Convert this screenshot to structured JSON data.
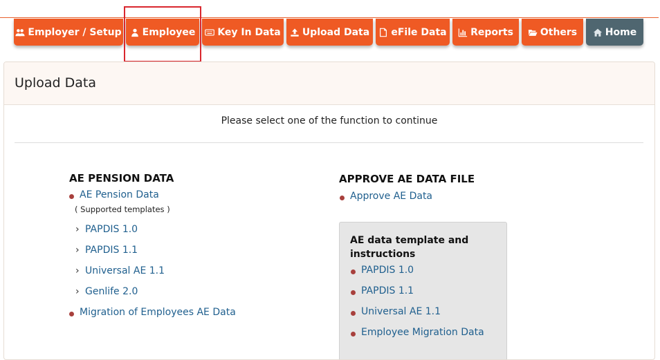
{
  "nav": {
    "items": [
      {
        "label": "Employer / Setup",
        "icon": "users-icon"
      },
      {
        "label": "Employee",
        "icon": "user-icon"
      },
      {
        "label": "Key In Data",
        "icon": "keyboard-icon"
      },
      {
        "label": "Upload Data",
        "icon": "upload-icon"
      },
      {
        "label": "eFile Data",
        "icon": "file-icon"
      },
      {
        "label": "Reports",
        "icon": "bar-chart-icon"
      },
      {
        "label": "Others",
        "icon": "folder-open-icon"
      },
      {
        "label": "Home",
        "icon": "home-icon"
      }
    ],
    "colors": {
      "primary": "#ef5a24",
      "home": "#4f6670",
      "highlight": "#d9272e"
    }
  },
  "panel": {
    "title": "Upload Data",
    "prompt": "Please select one of the function to continue"
  },
  "left": {
    "heading": "AE PENSION DATA",
    "main_link": "AE Pension Data",
    "note": "( Supported templates )",
    "templates": [
      "PAPDIS 1.0",
      "PAPDIS 1.1",
      "Universal AE 1.1",
      "Genlife 2.0"
    ],
    "migration_link": "Migration of Employees AE Data"
  },
  "right": {
    "heading": "APPROVE AE DATA FILE",
    "approve_link": "Approve AE Data",
    "box_title": "AE data template and instructions",
    "box_links": [
      "PAPDIS 1.0",
      "PAPDIS 1.1",
      "Universal AE 1.1",
      "Employee Migration Data"
    ]
  },
  "colors": {
    "link": "#1f5f8e",
    "bullet": "#a8403d"
  }
}
